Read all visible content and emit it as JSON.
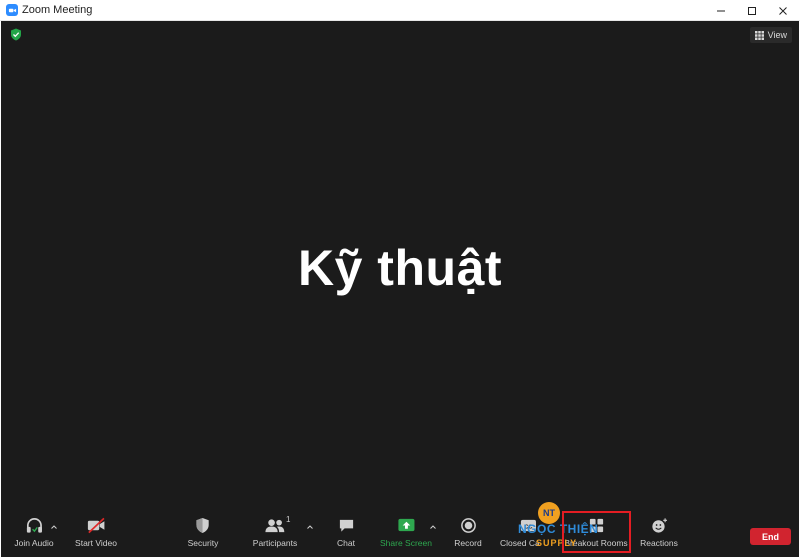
{
  "window": {
    "title": "Zoom Meeting"
  },
  "stage": {
    "view_label": "View",
    "main_text": "Kỹ thuật"
  },
  "toolbar": {
    "join_audio": "Join Audio",
    "start_video": "Start Video",
    "security": "Security",
    "participants": "Participants",
    "participants_count": "1",
    "chat": "Chat",
    "share_screen": "Share Screen",
    "record": "Record",
    "closed_captions": "Closed Ca",
    "breakout_rooms": "Breakout Rooms",
    "reactions": "Reactions",
    "end": "End"
  },
  "watermark": {
    "logo_text": "NT",
    "name": "NGỌC THIỆN",
    "sub": "SUPPLY"
  },
  "colors": {
    "stage_bg": "#1b1b1b",
    "share_green": "#2ea84f",
    "end_red": "#d1242f",
    "highlight_red": "#e41d23",
    "zoom_blue": "#2d8cff"
  }
}
